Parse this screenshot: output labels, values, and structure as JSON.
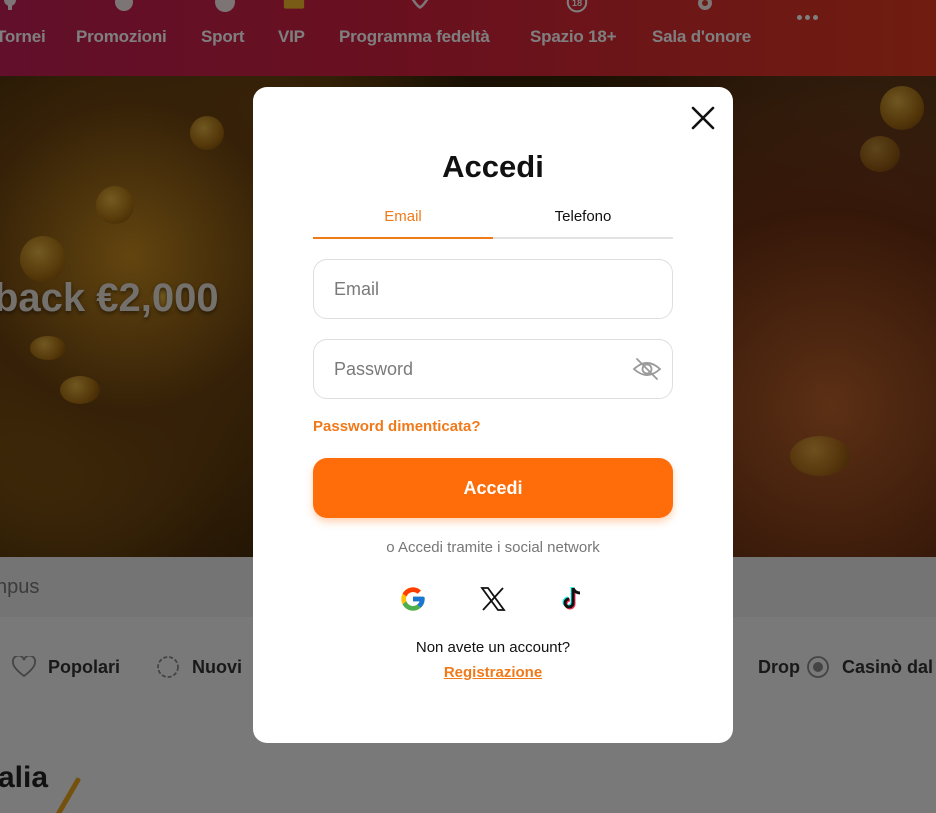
{
  "nav": {
    "items": [
      {
        "label": "Tornei",
        "icon": "trophy-icon"
      },
      {
        "label": "Promozioni",
        "icon": "gift-icon"
      },
      {
        "label": "Sport",
        "icon": "ball-icon"
      },
      {
        "label": "VIP",
        "icon": "crown-icon"
      },
      {
        "label": "Programma fedeltà",
        "icon": "laurel-icon"
      },
      {
        "label": "Spazio 18+",
        "icon": "age-18-icon"
      },
      {
        "label": "Sala d'onore",
        "icon": "medal-icon"
      }
    ],
    "more_icon": "more-dots-icon"
  },
  "hero": {
    "title": "back €2,000"
  },
  "search": {
    "placeholder_partial": "npus"
  },
  "categories": [
    {
      "label": "Popolari",
      "icon": "heart-icon"
    },
    {
      "label": "Nuovi",
      "icon": "new-badge-icon"
    },
    {
      "label": "Drop",
      "icon": "drop-icon"
    },
    {
      "label": "Casinò dal",
      "icon": "live-dot-icon"
    }
  ],
  "section": {
    "title": "alia"
  },
  "modal": {
    "title": "Accedi",
    "tabs": {
      "email": "Email",
      "phone": "Telefono",
      "active": "email"
    },
    "email_placeholder": "Email",
    "password_placeholder": "Password",
    "forgot_password": "Password dimenticata?",
    "submit_label": "Accedi",
    "social_caption": "o Accedi tramite i social network",
    "social": [
      {
        "name": "Google",
        "icon": "google-icon"
      },
      {
        "name": "X",
        "icon": "x-icon"
      },
      {
        "name": "TikTok",
        "icon": "tiktok-icon"
      }
    ],
    "no_account": "Non avete un account?",
    "register": "Registrazione"
  },
  "colors": {
    "accent": "#ff6d0a",
    "accent_text": "#f07a1a",
    "nav_gradient_start": "#c21e55",
    "nav_gradient_end": "#e03a1f",
    "overlay": "rgba(0,0,0,0.5)"
  }
}
